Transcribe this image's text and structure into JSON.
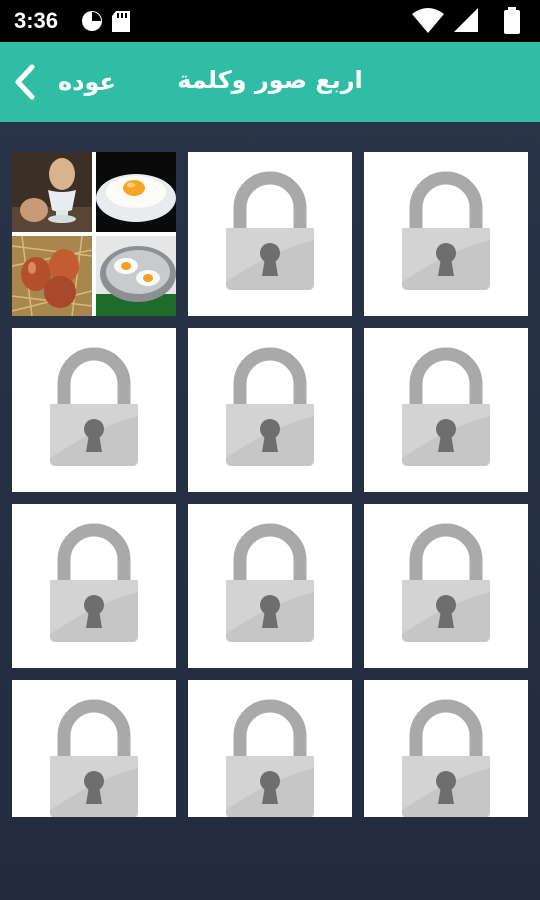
{
  "status_bar": {
    "time": "3:36",
    "left_icons": [
      "stopwatch-icon",
      "sd-card-icon"
    ],
    "right_icons": [
      "wifi-icon",
      "cell-signal-icon",
      "battery-icon"
    ]
  },
  "app_bar": {
    "title": "اربع صور وكلمة",
    "back_label": "عوده",
    "back_icon": "chevron-left-icon"
  },
  "colors": {
    "accent": "#2fbda5",
    "background": "#252f42",
    "tile": "#ffffff",
    "lock": "#bdbdbd"
  },
  "levels": {
    "total": 12,
    "unlocked": 1,
    "unlocked_preview_images": [
      "egg-in-cup-image",
      "fried-egg-plate-image",
      "eggs-in-nest-image",
      "eggs-in-pan-image"
    ],
    "locked_icon": "padlock-icon"
  }
}
